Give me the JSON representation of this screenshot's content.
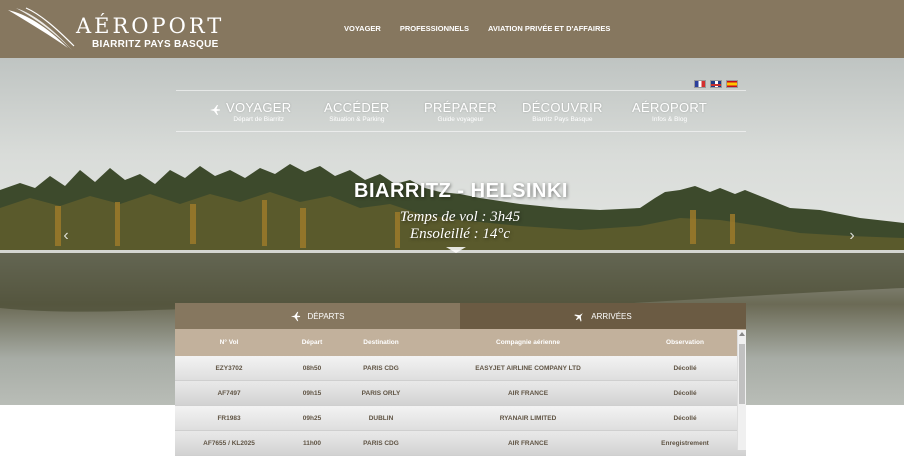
{
  "header": {
    "logo_title": "AÉROPORT",
    "logo_subtitle": "BIARRITZ PAYS BASQUE",
    "nav": [
      "VOYAGER",
      "PROFESSIONNELS",
      "AVIATION PRIVÉE ET D'AFFAIRES"
    ]
  },
  "languages": [
    "fr",
    "en",
    "es"
  ],
  "main_nav": [
    {
      "title": "VOYAGER",
      "subtitle": "Départ de Biarritz"
    },
    {
      "title": "ACCÉDER",
      "subtitle": "Situation & Parking"
    },
    {
      "title": "PRÉPARER",
      "subtitle": "Guide voyageur"
    },
    {
      "title": "DÉCOUVRIR",
      "subtitle": "Biarritz Pays Basque"
    },
    {
      "title": "AÉROPORT",
      "subtitle": "Infos & Blog"
    }
  ],
  "hero": {
    "destination": "BIARRITZ - HELSINKI",
    "flight_time": "Temps de vol : 3h45",
    "weather": "Ensoleillé : 14°c"
  },
  "flights": {
    "tabs": [
      "DÉPARTS",
      "ARRIVÉES"
    ],
    "columns": [
      "N° Vol",
      "Départ",
      "Destination",
      "Compagnie aérienne",
      "Observation"
    ],
    "rows": [
      [
        "EZY3702",
        "08h50",
        "PARIS CDG",
        "EASYJET AIRLINE COMPANY LTD",
        "Décollé"
      ],
      [
        "AF7497",
        "09h15",
        "PARIS ORLY",
        "AIR FRANCE",
        "Décollé"
      ],
      [
        "FR1983",
        "09h25",
        "DUBLIN",
        "RYANAIR LIMITED",
        "Décollé"
      ],
      [
        "AF7655 / KL2025",
        "11h00",
        "PARIS CDG",
        "AIR FRANCE",
        "Enregistrement"
      ]
    ]
  },
  "colors": {
    "header_bg": "#86775f",
    "tab_inactive": "#6b5b43",
    "table_header": "#c2b19c",
    "row_text": "#5f5343"
  }
}
